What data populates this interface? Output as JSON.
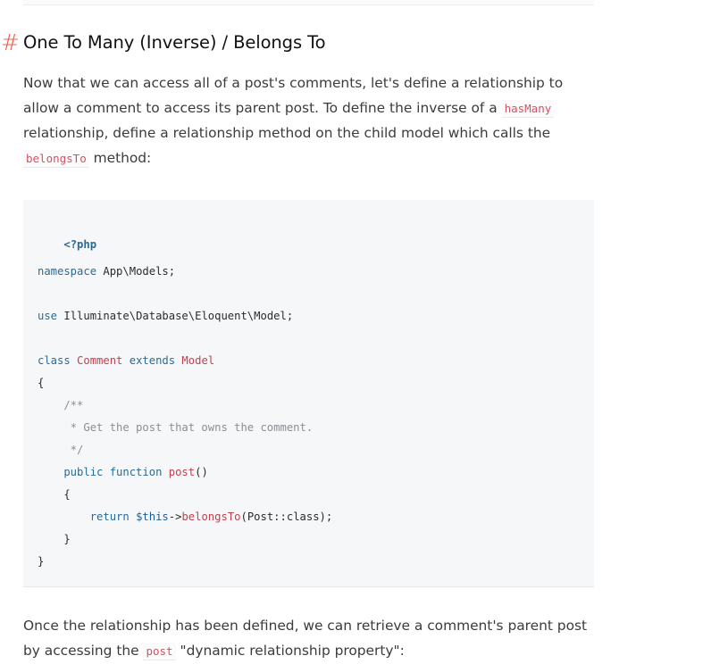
{
  "section": {
    "hash": "#",
    "title": "One To Many (Inverse) / Belongs To"
  },
  "intro": {
    "line1": "Now that we can access all of a post's comments, let's define a relationship to",
    "line2_a": "allow a comment to access its parent post. To define the inverse of a ",
    "line2_code": "hasMany",
    "line3": "relationship, define a relationship method on the child model which calls the",
    "line4_code": "belongsTo",
    "line4_b": " method:"
  },
  "code": {
    "l1": "<?php",
    "l2_kw": "namespace",
    "l2_rest": " App\\Models;",
    "l3_kw": "use",
    "l3_rest": " Illuminate\\Database\\Eloquent\\Model;",
    "l4_kw1": "class",
    "l4_cls": " Comment",
    "l4_kw2": " extends",
    "l4_cls2": " Model",
    "l5": "{",
    "l6": "    /**",
    "l7": "     * Get the post that owns the comment.",
    "l8": "     */",
    "l9_kw": "    public function",
    "l9_fn": " post",
    "l9_rest": "()",
    "l10": "    {",
    "l11_kw": "        return",
    "l11_var": " $this",
    "l11_arrow": "->",
    "l11_fn": "belongsTo",
    "l11_rest": "(Post::class);",
    "l12": "    }",
    "l13": "}"
  },
  "outro": {
    "line1": "Once the relationship has been defined, we can retrieve a comment's parent post",
    "line2_a": "by accessing the ",
    "line2_code": "post",
    "line2_b": " \"dynamic relationship property\":"
  }
}
